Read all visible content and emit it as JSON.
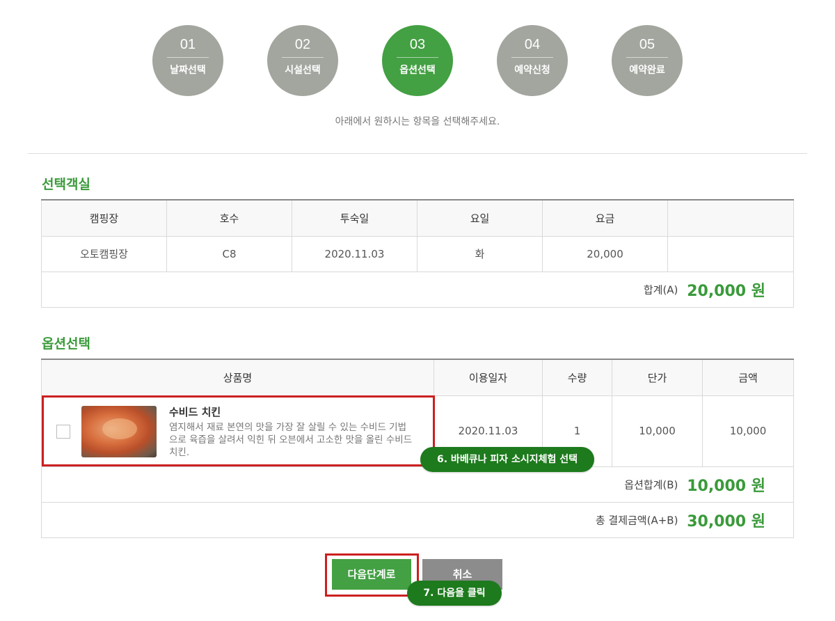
{
  "steps": [
    {
      "num": "01",
      "label": "날짜선택"
    },
    {
      "num": "02",
      "label": "시설선택"
    },
    {
      "num": "03",
      "label": "옵션선택"
    },
    {
      "num": "04",
      "label": "예약신청"
    },
    {
      "num": "05",
      "label": "예약완료"
    }
  ],
  "subtitle": "아래에서 원하시는 항목을 선택해주세요.",
  "room_section": {
    "title": "선택객실",
    "headers": [
      "캠핑장",
      "호수",
      "투숙일",
      "요일",
      "요금",
      ""
    ],
    "row": [
      "오토캠핑장",
      "C8",
      "2020.11.03",
      "화",
      "20,000",
      ""
    ],
    "sum_label": "합계(A)",
    "sum_value": "20,000 원"
  },
  "option_section": {
    "title": "옵션선택",
    "headers": [
      "상품명",
      "이용일자",
      "수량",
      "단가",
      "금액"
    ],
    "product": {
      "name": "수비드 치킨",
      "description": "염지해서 재료 본연의 맛을 가장 잘 살릴 수 있는 수비드 기법으로 육즙을 살려서 익힌 뒤 오븐에서 고소한 맛을 올린 수비드 치킨.",
      "date": "2020.11.03",
      "qty": "1",
      "unit_price": "10,000",
      "amount": "10,000"
    },
    "option_sum_label": "옵션합계(B)",
    "option_sum_value": "10,000 원",
    "total_label": "총 결제금액(A+B)",
    "total_value": "30,000 원"
  },
  "buttons": {
    "next": "다음단계로",
    "cancel": "취소"
  },
  "tooltips": {
    "step6": "6. 바베큐나 피자 소시지체험 선택",
    "step7": "7. 다음을 클릭"
  },
  "colors": {
    "accent": "#43a043",
    "inactive_step": "#a3a69f",
    "highlight": "#cc1f1f",
    "tooltip": "#1d7a1d"
  }
}
